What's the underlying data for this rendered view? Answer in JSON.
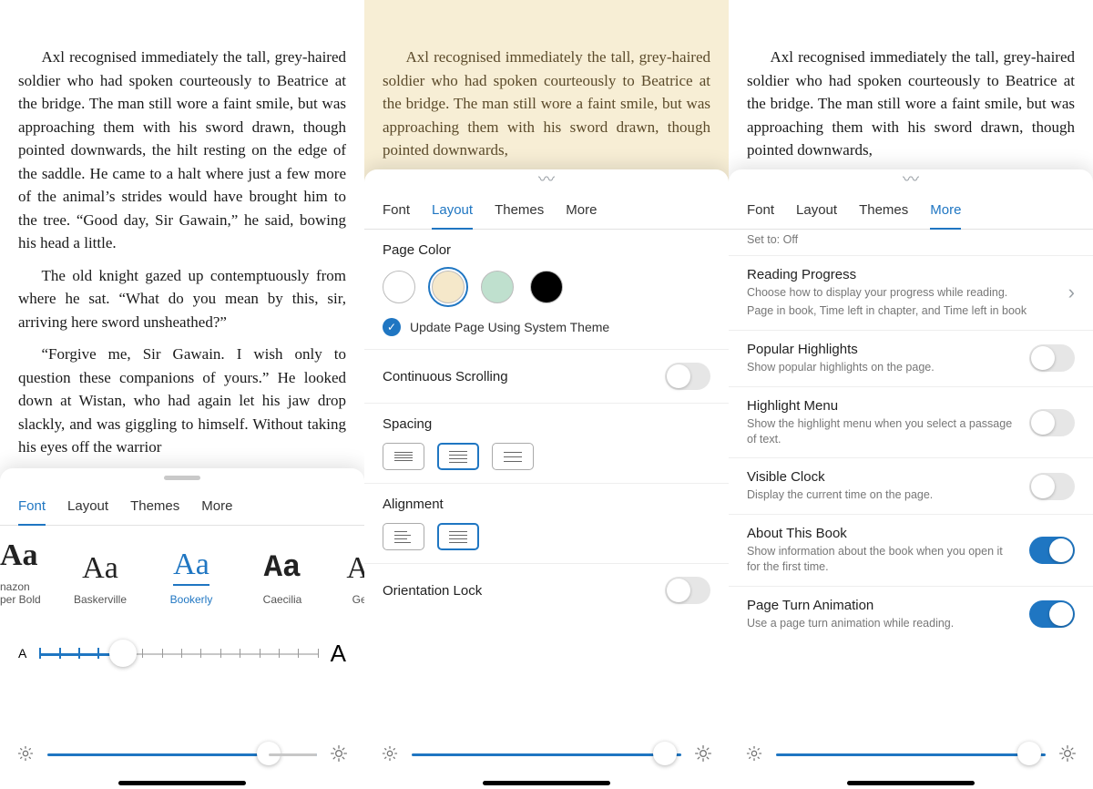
{
  "book": {
    "p1": "Axl recognised immediately the tall, grey-haired soldier who had spoken courteously to Beatrice at the bridge. The man still wore a faint smile, but was approaching them with his sword drawn, though pointed downwards, the hilt resting on the edge of the saddle. He came to a halt where just a few more of the animal’s strides would have brought him to the tree. “Good day, Sir Gawain,” he said, bowing his head a little.",
    "p2": "The old knight gazed up contemptuously from where he sat. “What do you mean by this, sir, arriving here sword unsheathed?”",
    "p3": "“Forgive me, Sir Gawain. I wish only to question these companions of yours.” He looked down at Wistan, who had again let his jaw drop slackly, and was giggling to himself. Without taking his eyes off the warrior",
    "short": "Axl recognised immediately the tall, grey-haired soldier who had spoken courteously to Beatrice at the bridge. The man still wore a faint smile, but was approaching them with his sword drawn, though pointed downwards,"
  },
  "tabs": {
    "font": "Font",
    "layout": "Layout",
    "themes": "Themes",
    "more": "More"
  },
  "fontPanel": {
    "fonts": [
      {
        "sample": "Aa",
        "name": "nazon\nper Bold"
      },
      {
        "sample": "Aa",
        "name": "Baskerville"
      },
      {
        "sample": "Aa",
        "name": "Bookerly"
      },
      {
        "sample": "Aa",
        "name": "Caecilia"
      },
      {
        "sample": "Aa",
        "name": "Georg"
      }
    ],
    "sizeSmall": "A",
    "sizeLarge": "A"
  },
  "layoutPanel": {
    "pageColor": "Page Color",
    "systemTheme": "Update Page Using System Theme",
    "continuous": "Continuous Scrolling",
    "spacing": "Spacing",
    "alignment": "Alignment",
    "orientation": "Orientation Lock",
    "colors": {
      "white": "#ffffff",
      "sepia": "#f5e8ca",
      "green": "#bfe0ce",
      "black": "#000000"
    }
  },
  "morePanel": {
    "setTo": "Set to: Off",
    "items": [
      {
        "title": "Reading Progress",
        "sub": "Choose how to display your progress while reading.",
        "sub2": "Page in book, Time left in chapter, and Time left in book",
        "chevron": true
      },
      {
        "title": "Popular Highlights",
        "sub": "Show popular highlights on the page.",
        "toggle": false
      },
      {
        "title": "Highlight Menu",
        "sub": "Show the highlight menu when you select a passage of text.",
        "toggle": false
      },
      {
        "title": "Visible Clock",
        "sub": "Display the current time on the page.",
        "toggle": false
      },
      {
        "title": "About This Book",
        "sub": "Show information about the book when you open it for the first time.",
        "toggle": true
      },
      {
        "title": "Page Turn Animation",
        "sub": "Use a page turn animation while reading.",
        "toggle": true
      }
    ]
  }
}
